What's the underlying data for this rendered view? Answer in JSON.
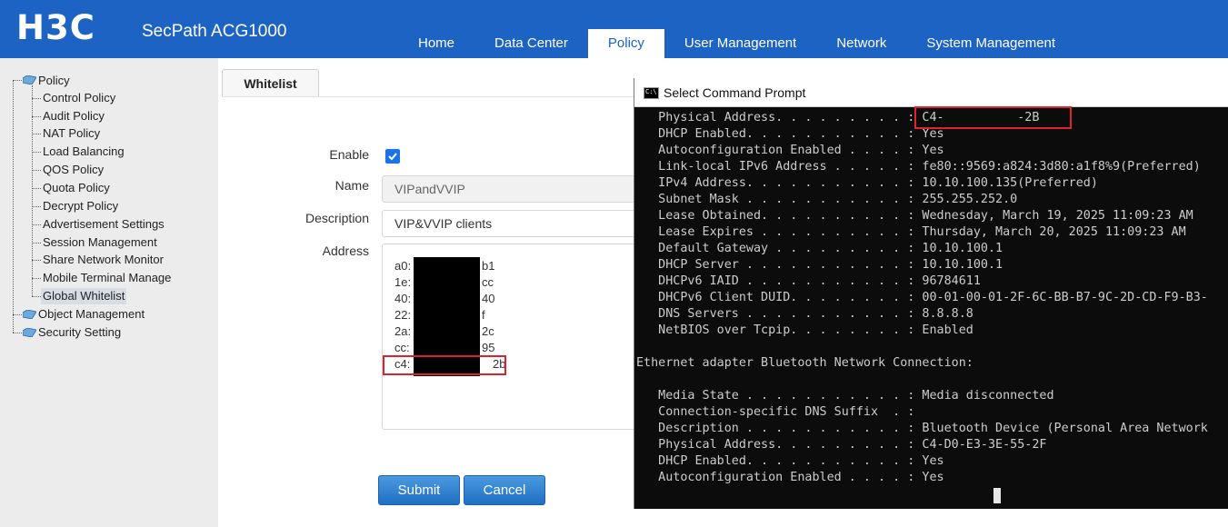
{
  "header": {
    "logo": "H3C",
    "product": "SecPath ACG1000",
    "nav": [
      "Home",
      "Data Center",
      "Policy",
      "User Management",
      "Network",
      "System Management"
    ],
    "active_nav": "Policy"
  },
  "sidebar": {
    "root": "Policy",
    "items": [
      "Control Policy",
      "Audit Policy",
      "NAT Policy",
      "Load Balancing",
      "QOS Policy",
      "Quota Policy",
      "Decrypt Policy",
      "Advertisement Settings",
      "Session Management",
      "Share Network Monitor",
      "Mobile Terminal Manage",
      "Global Whitelist"
    ],
    "selected": "Global Whitelist",
    "other_roots": [
      "Object Management",
      "Security Setting"
    ]
  },
  "tab": {
    "label": "Whitelist"
  },
  "form": {
    "enable_label": "Enable",
    "enable_checked": true,
    "name_label": "Name",
    "name_value": "VIPandVVIP",
    "description_label": "Description",
    "description_value": "VIP&VVIP clients",
    "address_label": "Address",
    "addresses": [
      "a0:",
      "1e:",
      "40:",
      "22:",
      "2a:",
      "cc:",
      "c4:"
    ],
    "address_suffixes": [
      "b1",
      "cc",
      "40",
      "f",
      "2c",
      "95",
      "2b"
    ],
    "submit_label": "Submit",
    "cancel_label": "Cancel"
  },
  "cmd": {
    "title": "Select Command Prompt",
    "icon_text": "C:\\",
    "lines": [
      "   Physical Address. . . . . . . . . : C4-          -2B",
      "   DHCP Enabled. . . . . . . . . . . : Yes",
      "   Autoconfiguration Enabled . . . . : Yes",
      "   Link-local IPv6 Address . . . . . : fe80::9569:a824:3d80:a1f8%9(Preferred)",
      "   IPv4 Address. . . . . . . . . . . : 10.10.100.135(Preferred)",
      "   Subnet Mask . . . . . . . . . . . : 255.255.252.0",
      "   Lease Obtained. . . . . . . . . . : Wednesday, March 19, 2025 11:09:23 AM",
      "   Lease Expires . . . . . . . . . . : Thursday, March 20, 2025 11:09:23 AM",
      "   Default Gateway . . . . . . . . . : 10.10.100.1",
      "   DHCP Server . . . . . . . . . . . : 10.10.100.1",
      "   DHCPv6 IAID . . . . . . . . . . . : 96784611",
      "   DHCPv6 Client DUID. . . . . . . . : 00-01-00-01-2F-6C-BB-B7-9C-2D-CD-F9-B3-",
      "   DNS Servers . . . . . . . . . . . : 8.8.8.8",
      "   NetBIOS over Tcpip. . . . . . . . : Enabled",
      "",
      "Ethernet adapter Bluetooth Network Connection:",
      "",
      "   Media State . . . . . . . . . . . : Media disconnected",
      "   Connection-specific DNS Suffix  . :",
      "   Description . . . . . . . . . . . : Bluetooth Device (Personal Area Network",
      "   Physical Address. . . . . . . . . : C4-D0-E3-3E-55-2F",
      "   DHCP Enabled. . . . . . . . . . . : Yes",
      "   Autoconfiguration Enabled . . . . : Yes"
    ]
  }
}
